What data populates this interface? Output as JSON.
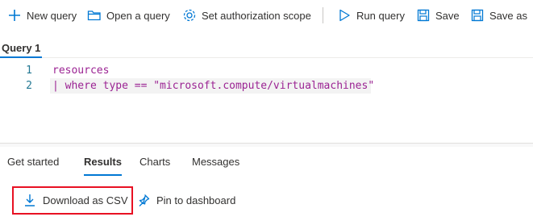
{
  "toolbar": {
    "new_query": "New query",
    "open_query": "Open a query",
    "set_scope": "Set authorization scope",
    "run_query": "Run query",
    "save": "Save",
    "save_as": "Save as"
  },
  "query_tab": {
    "label": "Query 1"
  },
  "editor": {
    "lines": [
      {
        "number": "1",
        "text": "resources"
      },
      {
        "number": "2",
        "text": "| where type == \"microsoft.compute/virtualmachines\""
      }
    ]
  },
  "results_tabs": [
    {
      "label": "Get started"
    },
    {
      "label": "Results"
    },
    {
      "label": "Charts"
    },
    {
      "label": "Messages"
    }
  ],
  "actions": {
    "download_csv": "Download as CSV",
    "pin_dashboard": "Pin to dashboard"
  },
  "colors": {
    "accent": "#0078d4",
    "highlight_border": "#e81123"
  }
}
